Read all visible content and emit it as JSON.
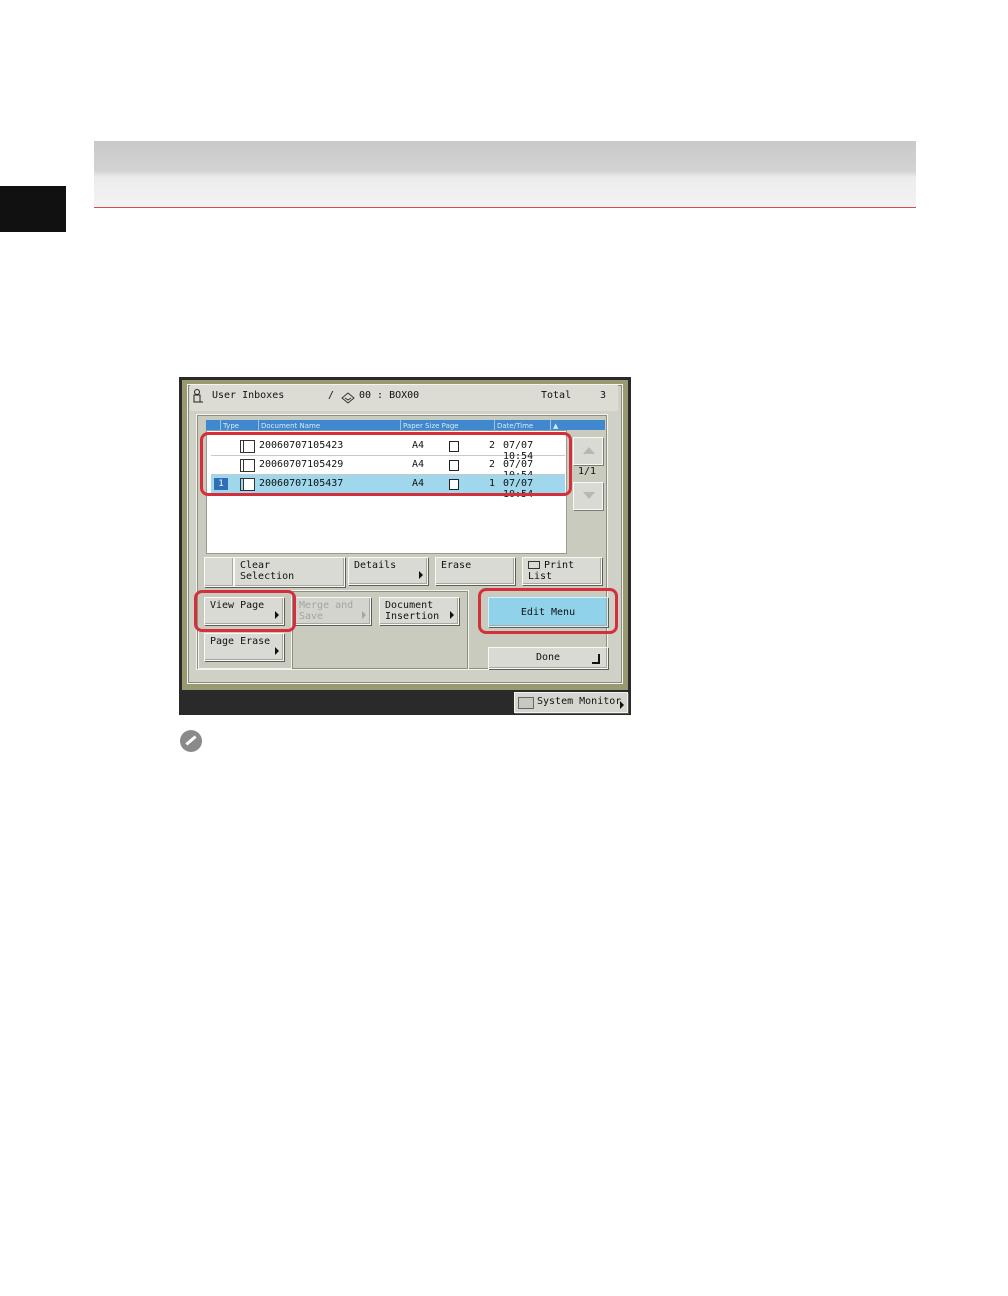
{
  "header": {
    "title": "User Inboxes",
    "path_separator": "/",
    "box_label": "00 : BOX00",
    "total_label": "Total",
    "total_value": "3"
  },
  "list": {
    "columns": [
      "Type",
      "Document Name",
      "Paper Size",
      "Page",
      "Date/Time",
      "▲"
    ],
    "rows": [
      {
        "number": "",
        "name": "20060707105423",
        "size": "A4",
        "pages": "2",
        "datetime": "07/07 10:54",
        "selected": false
      },
      {
        "number": "",
        "name": "20060707105429",
        "size": "A4",
        "pages": "2",
        "datetime": "07/07 10:54",
        "selected": false
      },
      {
        "number": "1",
        "name": "20060707105437",
        "size": "A4",
        "pages": "1",
        "datetime": "07/07 10:54",
        "selected": true
      }
    ],
    "page_indicator": "1/1"
  },
  "buttons": {
    "clear_selection": "Clear Selection",
    "details": "Details",
    "erase": "Erase",
    "print_list": "Print List",
    "view_page": "View Page",
    "merge_and_save": "Merge and Save",
    "document_insertion": "Document Insertion",
    "page_erase": "Page Erase",
    "edit_menu": "Edit Menu",
    "done": "Done"
  },
  "status_bar": {
    "system_monitor": "System Monitor"
  },
  "colors": {
    "highlight": "#d3303c",
    "selected_row": "#9fd7ec",
    "header_blue": "#3f88cf"
  }
}
